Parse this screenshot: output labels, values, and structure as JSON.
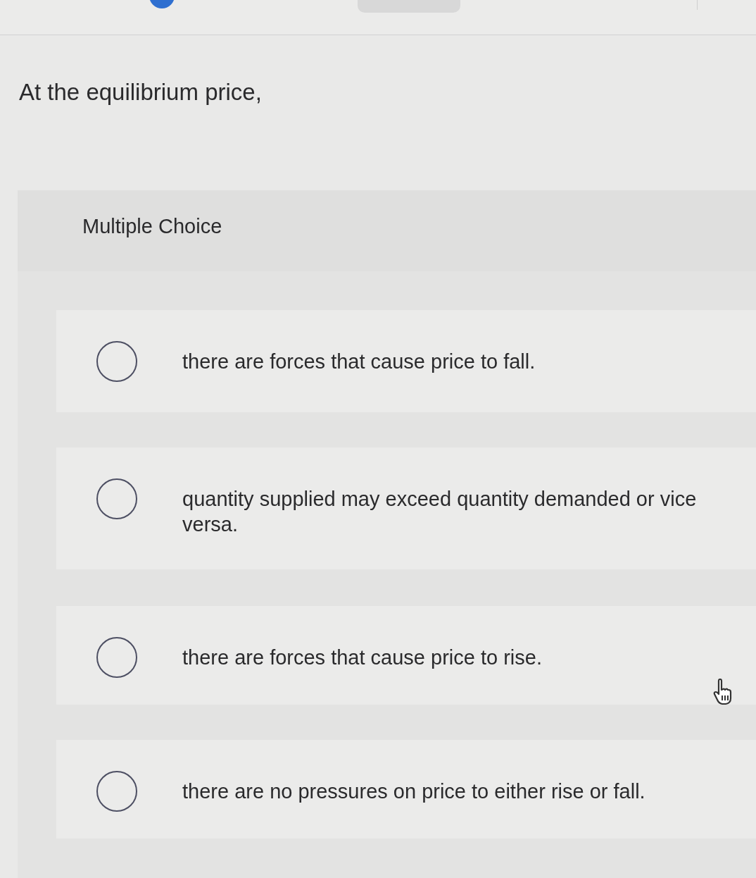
{
  "question": "At the equilibrium price,",
  "answer_panel": {
    "heading": "Multiple Choice",
    "options": [
      {
        "text": "there are forces that cause price to fall.",
        "selected": false
      },
      {
        "text": "quantity supplied may exceed quantity demanded or vice versa.",
        "selected": false
      },
      {
        "text": "there are forces that cause price to rise.",
        "selected": false
      },
      {
        "text": "there are no pressures on price to either rise or fall.",
        "selected": false
      }
    ]
  }
}
